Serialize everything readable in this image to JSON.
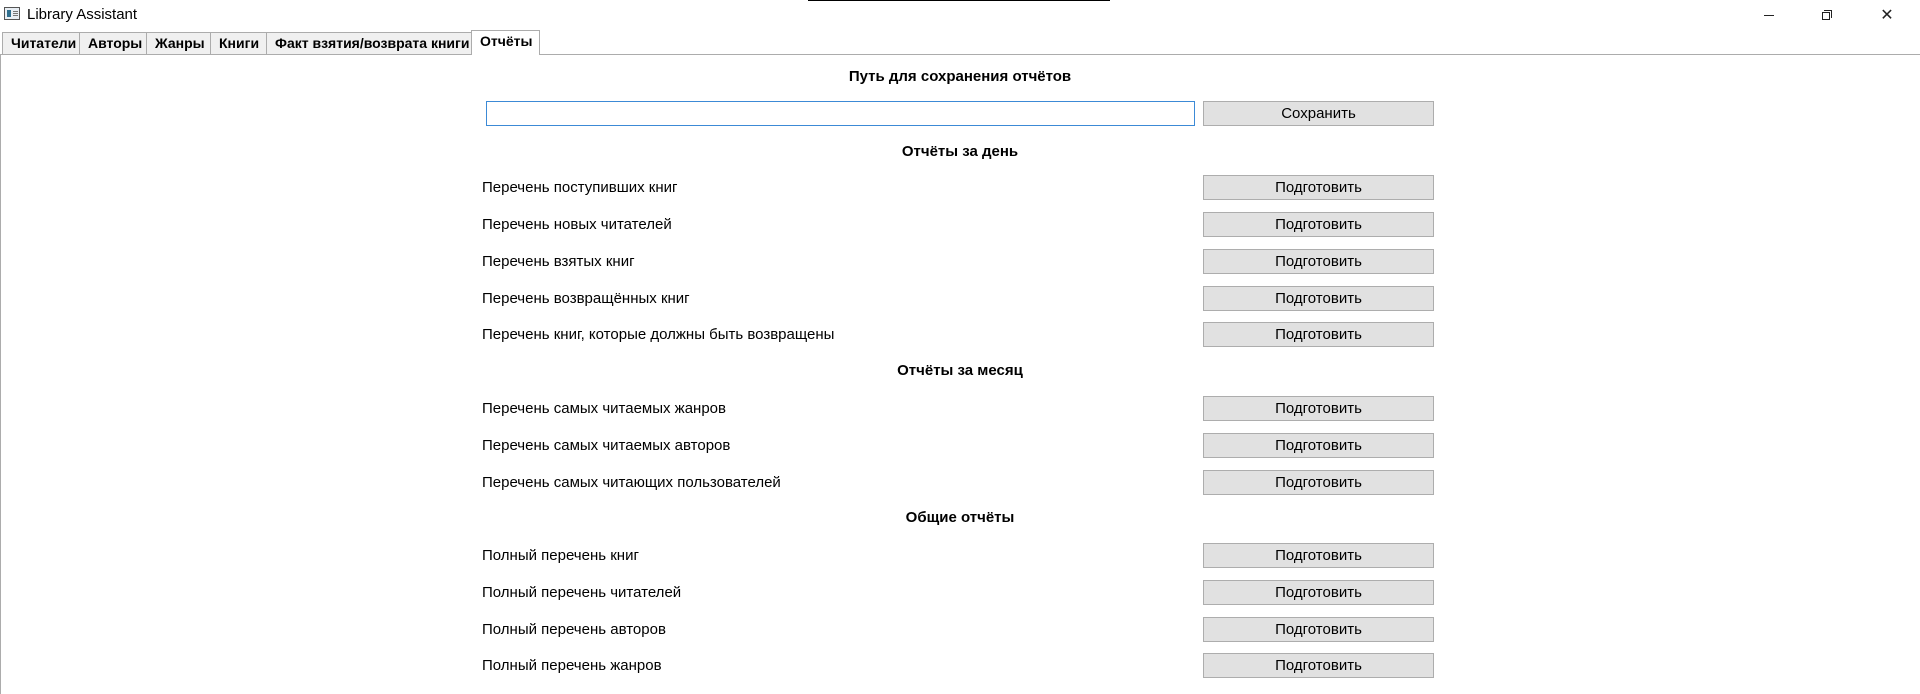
{
  "window": {
    "title": "Library Assistant",
    "min_glyph": "",
    "close_glyph": "✕"
  },
  "tabs": [
    {
      "label": "Читатели",
      "active": false
    },
    {
      "label": "Авторы",
      "active": false
    },
    {
      "label": "Жанры",
      "active": false
    },
    {
      "label": "Книги",
      "active": false
    },
    {
      "label": "Факт взятия/возврата книги",
      "active": false
    },
    {
      "label": "Отчёты",
      "active": true
    }
  ],
  "save_path": {
    "heading": "Путь для сохранения отчётов",
    "value": "",
    "save_label": "Сохранить"
  },
  "prepare_label": "Подготовить",
  "sections": {
    "daily": {
      "heading": "Отчёты за день",
      "items": [
        "Перечень поступивших книг",
        "Перечень новых читателей",
        "Перечень взятых книг",
        "Перечень возвращённых книг",
        "Перечень книг, которые должны быть возвращены"
      ]
    },
    "monthly": {
      "heading": "Отчёты за месяц",
      "items": [
        "Перечень самых читаемых жанров",
        "Перечень самых читаемых авторов",
        "Перечень самых читающих пользователей"
      ]
    },
    "general": {
      "heading": "Общие отчёты",
      "items": [
        "Полный перечень книг",
        "Полный перечень читателей",
        "Полный перечень авторов",
        "Полный перечень жанров"
      ]
    }
  }
}
